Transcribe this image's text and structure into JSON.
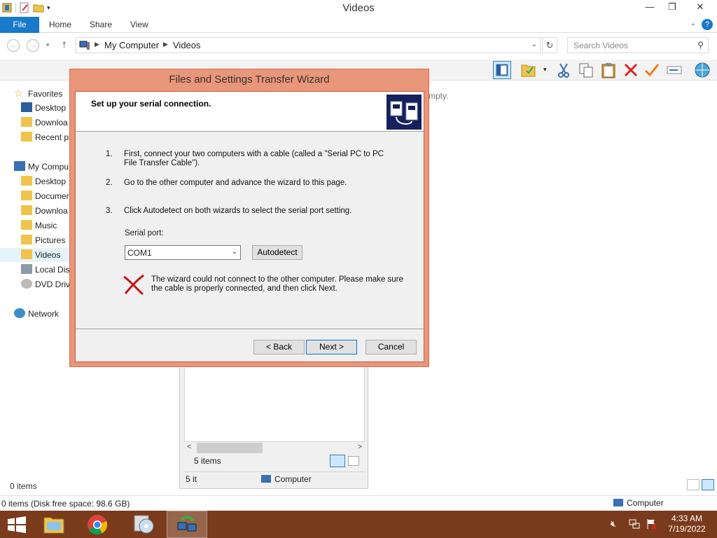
{
  "window": {
    "title": "Videos",
    "minimize": "—",
    "restore": "❐",
    "close": "✕"
  },
  "ribbon": {
    "tabs": [
      "File",
      "Home",
      "Share",
      "View"
    ],
    "help": "?"
  },
  "address": {
    "crumbs": [
      "My Computer",
      "Videos"
    ],
    "search_placeholder": "Search Videos"
  },
  "navpane": {
    "items": [
      {
        "label": "Favorites",
        "icon": "star-icon"
      },
      {
        "label": "Desktop",
        "icon": "desktop-icon"
      },
      {
        "label": "Downloa",
        "icon": "folder-icon"
      },
      {
        "label": "Recent pl",
        "icon": "folder-icon"
      },
      {
        "label": "My Compu",
        "icon": "computer-icon"
      },
      {
        "label": "Desktop",
        "icon": "folder-icon"
      },
      {
        "label": "Documen",
        "icon": "folder-icon"
      },
      {
        "label": "Downloa",
        "icon": "folder-icon"
      },
      {
        "label": "Music",
        "icon": "folder-icon"
      },
      {
        "label": "Pictures",
        "icon": "folder-icon"
      },
      {
        "label": "Videos",
        "icon": "folder-icon"
      },
      {
        "label": "Local Dis",
        "icon": "drive-icon"
      },
      {
        "label": "DVD Driv",
        "icon": "dvd-icon"
      },
      {
        "label": "Network",
        "icon": "network-icon"
      }
    ]
  },
  "content": {
    "empty_text": "mpty."
  },
  "status": {
    "items_count": "0 items",
    "bottom_left": "0 items (Disk free space: 98.6 GB)",
    "bottom_right": "Computer"
  },
  "subwindow": {
    "items_count": "5 items",
    "status_a": "5 it",
    "status_b": "Computer"
  },
  "dialog": {
    "title": "Files and Settings Transfer Wizard",
    "heading": "Set up your serial connection.",
    "steps": [
      {
        "num": "1.",
        "text": "First, connect your two computers with a cable (called a \"Serial PC to PC File Transfer Cable\")."
      },
      {
        "num": "2.",
        "text": "Go to the other computer and advance the wizard to this page."
      },
      {
        "num": "3.",
        "text": "Click Autodetect on both wizards to select the serial port setting."
      }
    ],
    "serial_port_label": "Serial port:",
    "serial_port_value": "COM1",
    "autodetect": "Autodetect",
    "error_text": "The wizard could not connect to the other computer. Please make sure the cable is properly connected, and then click Next.",
    "back": "< Back",
    "next": "Next >",
    "cancel": "Cancel"
  },
  "taskbar": {
    "time": "4:33 AM",
    "date": "7/19/2022"
  }
}
